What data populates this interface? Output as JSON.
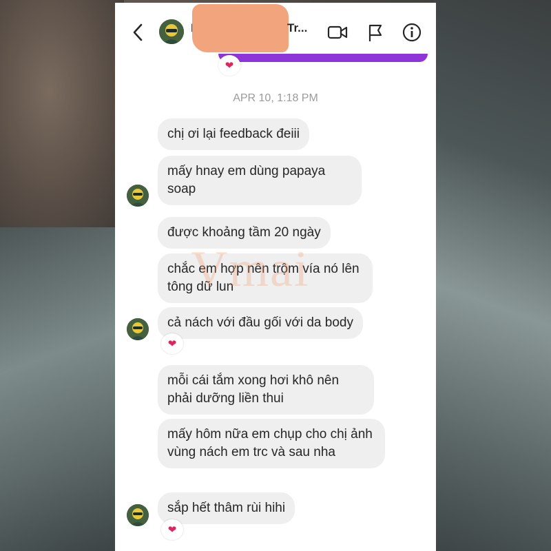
{
  "contact": {
    "name_start": "Kh",
    "name_end": "Tr..."
  },
  "timestamp": "APR 10, 1:18 PM",
  "messages": [
    "chị ơi lại feedback đeiii",
    "mấy hnay em dùng papaya soap",
    "được khoảng tầm 20 ngày",
    "chắc em hợp nên trộm vía nó lên tông dữ lun",
    "cả nách với đầu gối với da body",
    "mỗi cái tắm xong hơi khô nên phải dưỡng liền thui",
    "mấy hôm nữa em chụp cho chị ảnh vùng nách em trc và sau nha",
    "sắp hết thâm rùi hihi"
  ],
  "reaction": "❤",
  "watermark": "Vmai",
  "icons": [
    "back-icon",
    "video-call-icon",
    "flag-icon",
    "info-icon",
    "heart-reaction-icon"
  ],
  "colors": {
    "accent": "#8e34d8",
    "bubble": "#efefef",
    "redaction": "#f2a57c"
  }
}
